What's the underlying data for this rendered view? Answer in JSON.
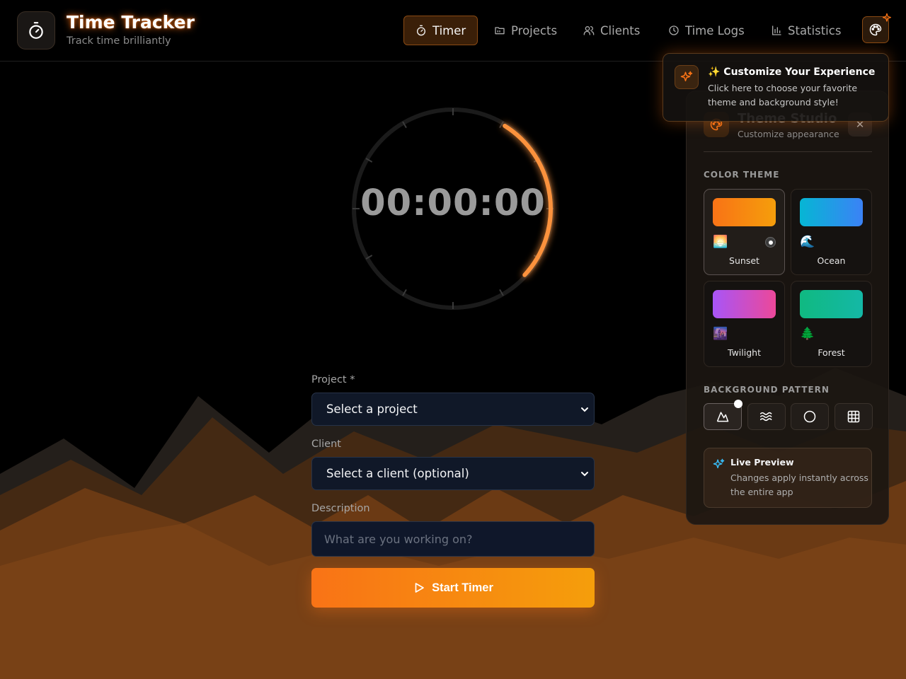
{
  "app": {
    "title": "Time Tracker",
    "subtitle": "Track time brilliantly",
    "logo_icon": "stopwatch-icon"
  },
  "nav": {
    "items": [
      {
        "label": "Timer",
        "icon": "stopwatch-icon",
        "active": true
      },
      {
        "label": "Projects",
        "icon": "folder-icon",
        "active": false
      },
      {
        "label": "Clients",
        "icon": "users-icon",
        "active": false
      },
      {
        "label": "Time Logs",
        "icon": "clock-icon",
        "active": false
      },
      {
        "label": "Statistics",
        "icon": "bar-chart-icon",
        "active": false
      }
    ],
    "theme_button_icon": "palette-icon"
  },
  "timer": {
    "display": "00:00:00",
    "progress_fraction": 0.28
  },
  "form": {
    "project_label": "Project *",
    "project_value": "Select a project",
    "client_label": "Client",
    "client_value": "Select a client (optional)",
    "description_label": "Description",
    "description_placeholder": "What are you working on?",
    "start_label": "Start Timer"
  },
  "tooltip": {
    "title": "✨ Customize Your Experience",
    "text": "Click here to choose your favorite theme and background style!"
  },
  "theme_panel": {
    "title": "Theme Studio",
    "subtitle": "Customize appearance",
    "close_label": "✕",
    "color_theme_heading": "COLOR THEME",
    "themes": [
      {
        "name": "Sunset",
        "emoji": "🌅",
        "from": "#f97316",
        "to": "#f59e0b",
        "selected": true
      },
      {
        "name": "Ocean",
        "emoji": "🌊",
        "from": "#06b6d4",
        "to": "#3b82f6",
        "selected": false
      },
      {
        "name": "Twilight",
        "emoji": "🌆",
        "from": "#a855f7",
        "to": "#ec4899",
        "selected": false
      },
      {
        "name": "Forest",
        "emoji": "🌲",
        "from": "#10b981",
        "to": "#14b8a6",
        "selected": false
      }
    ],
    "background_heading": "BACKGROUND PATTERN",
    "patterns": [
      {
        "name": "mountains",
        "icon": "mountain-icon",
        "selected": true
      },
      {
        "name": "waves",
        "icon": "waves-icon",
        "selected": false
      },
      {
        "name": "circle",
        "icon": "circle-icon",
        "selected": false
      },
      {
        "name": "grid",
        "icon": "grid-icon",
        "selected": false
      }
    ],
    "preview_title": "Live Preview",
    "preview_text": "Changes apply instantly across the entire app"
  },
  "colors": {
    "accent": "#f97316",
    "accent_secondary": "#f59e0b",
    "background": "#000000",
    "mountain": "#7a3f13"
  }
}
